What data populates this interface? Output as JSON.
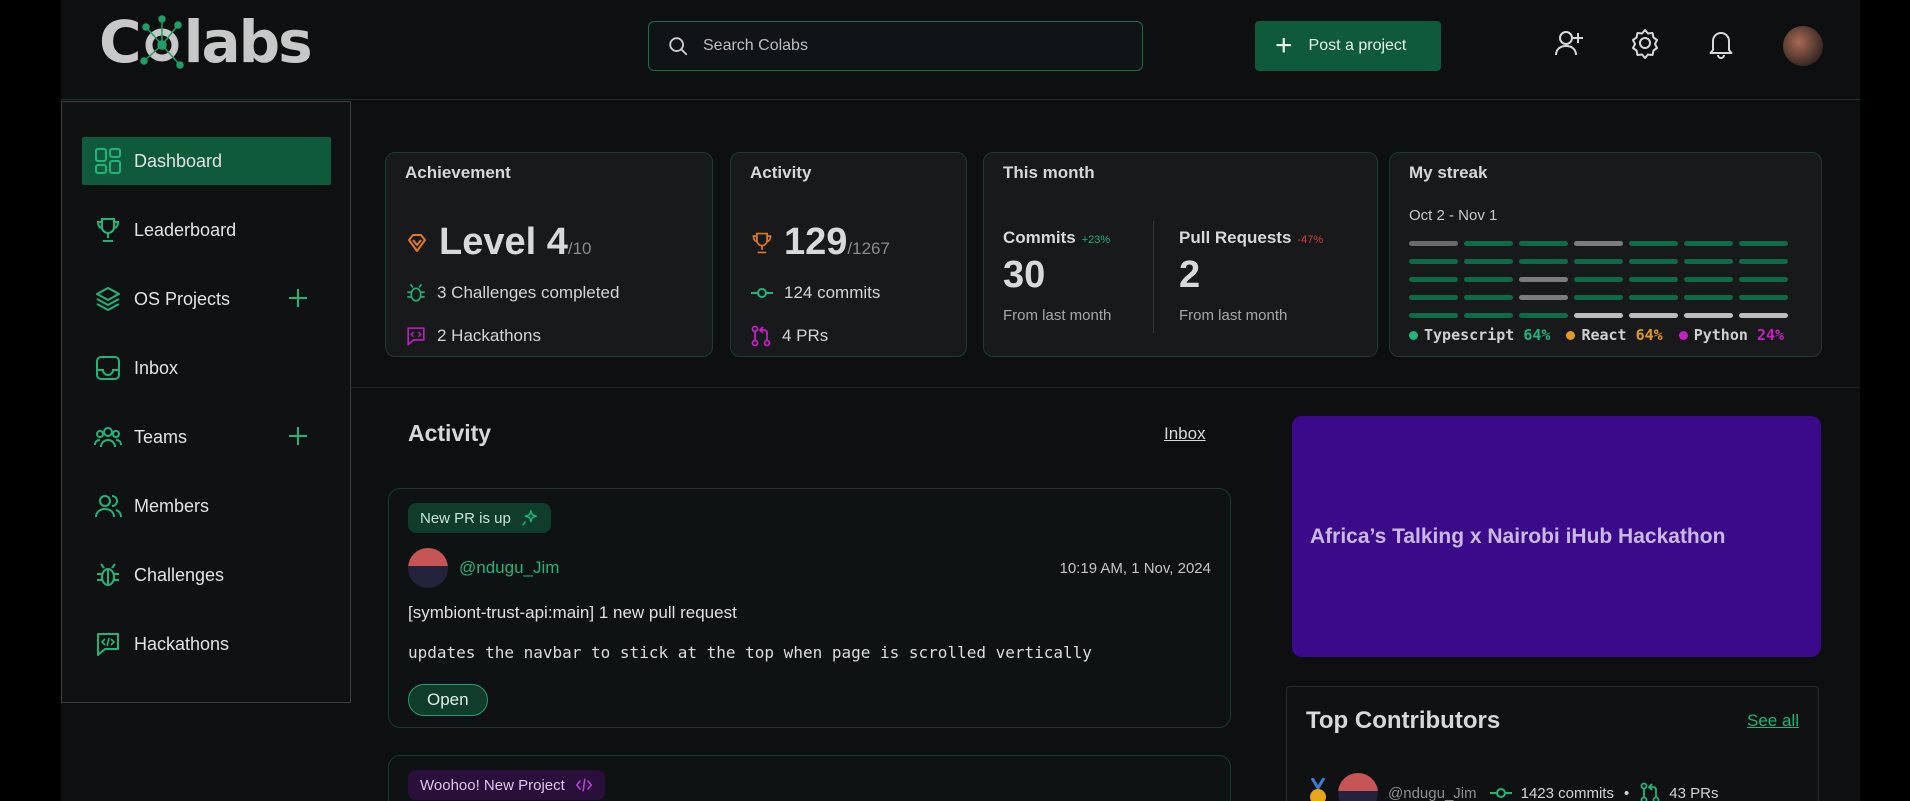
{
  "header": {
    "logo": {
      "text": "Colabs"
    },
    "search": {
      "placeholder": "Search Colabs"
    },
    "post_button": "Post a project",
    "icons": [
      "add-user-icon",
      "settings-icon",
      "notification-bell-icon",
      "user-avatar"
    ]
  },
  "sidebar": {
    "items": [
      {
        "label": "Dashboard",
        "icon": "dashboard-icon",
        "active": true
      },
      {
        "label": "Leaderboard",
        "icon": "trophy-icon"
      },
      {
        "label": "OS Projects",
        "icon": "layers-icon",
        "has_add": true
      },
      {
        "label": "Inbox",
        "icon": "inbox-icon"
      },
      {
        "label": "Teams",
        "icon": "team-icon",
        "has_add": true
      },
      {
        "label": "Members",
        "icon": "members-icon"
      },
      {
        "label": "Challenges",
        "icon": "bug-icon"
      },
      {
        "label": "Hackathons",
        "icon": "code-chat-icon"
      }
    ]
  },
  "stats": {
    "achievement": {
      "title": "Achievement",
      "level": "Level 4",
      "level_total": "/10",
      "challenges": "3 Challenges completed",
      "hackathons": "2 Hackathons"
    },
    "activity": {
      "title": "Activity",
      "value": "129",
      "total": "/1267",
      "commits": "124 commits",
      "prs": "4 PRs"
    },
    "this_month": {
      "title": "This month",
      "commits_label": "Commits",
      "commits_change": "+23%",
      "commits_value": "30",
      "commits_sub": "From last month",
      "prs_label": "Pull Requests",
      "prs_change": "-47%",
      "prs_value": "2",
      "prs_sub": "From last month"
    },
    "streak": {
      "title": "My streak",
      "range": "Oct 2 - Nov 1",
      "languages": [
        {
          "name": "Typescript",
          "pct": "64%",
          "color": "#1fb57a"
        },
        {
          "name": "React",
          "pct": "64%",
          "color": "#e09a22"
        },
        {
          "name": "Python",
          "pct": "24%",
          "color": "#c520c4"
        }
      ]
    }
  },
  "activity_feed": {
    "title": "Activity",
    "inbox_link": "Inbox",
    "cards": [
      {
        "badge": "New PR is up",
        "user": "@ndugu_Jim",
        "time": "10:19 AM, 1 Nov, 2024",
        "title": "[symbiont-trust-api:main] 1 new pull request",
        "description": "updates the navbar to stick at the top when page is scrolled vertically",
        "status": "Open"
      },
      {
        "badge": "Woohoo! New Project"
      }
    ]
  },
  "hackathon_banner": {
    "title": "Africa’s Talking x Nairobi iHub Hackathon",
    "color": "#3b0a8a"
  },
  "top_contributors": {
    "title": "Top Contributors",
    "see_all": "See all",
    "rows": [
      {
        "user": "@ndugu_Jim",
        "commits": "1423 commits",
        "separator": "•",
        "prs": "43 PRs"
      }
    ]
  },
  "colors": {
    "accent": "#0e5a3a",
    "accent_text": "#22b57a"
  }
}
